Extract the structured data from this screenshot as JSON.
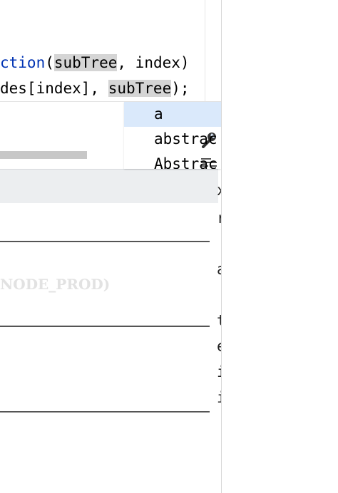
{
  "editor": {
    "line1": {
      "fn_suffix": "ction",
      "open_paren": "(",
      "arg1": "subTree",
      "rest": ", index)"
    },
    "line2": {
      "prefix": "des[index], ",
      "arg": "subTree",
      "suffix": ");"
    }
  },
  "popup": {
    "faded_text": "NODE_PROD)"
  },
  "completion": {
    "items": [
      {
        "icon": "wrench-icon",
        "label": "a",
        "selected": true
      },
      {
        "icon": "text-lines-icon",
        "label": "abstrac",
        "selected": false
      },
      {
        "icon": "link-icon",
        "label": "Abstrac",
        "selected": false
      }
    ]
  },
  "side_fragments": [
    {
      "text": "x"
    },
    {
      "text": "r"
    },
    {
      "text": "a"
    },
    {
      "text": "t"
    },
    {
      "text": "e"
    },
    {
      "text": "i"
    },
    {
      "text": "i"
    }
  ],
  "colors": {
    "keyword": "#0033b3",
    "highlight": "#d5d5d5",
    "selection": "#dae9fb"
  }
}
